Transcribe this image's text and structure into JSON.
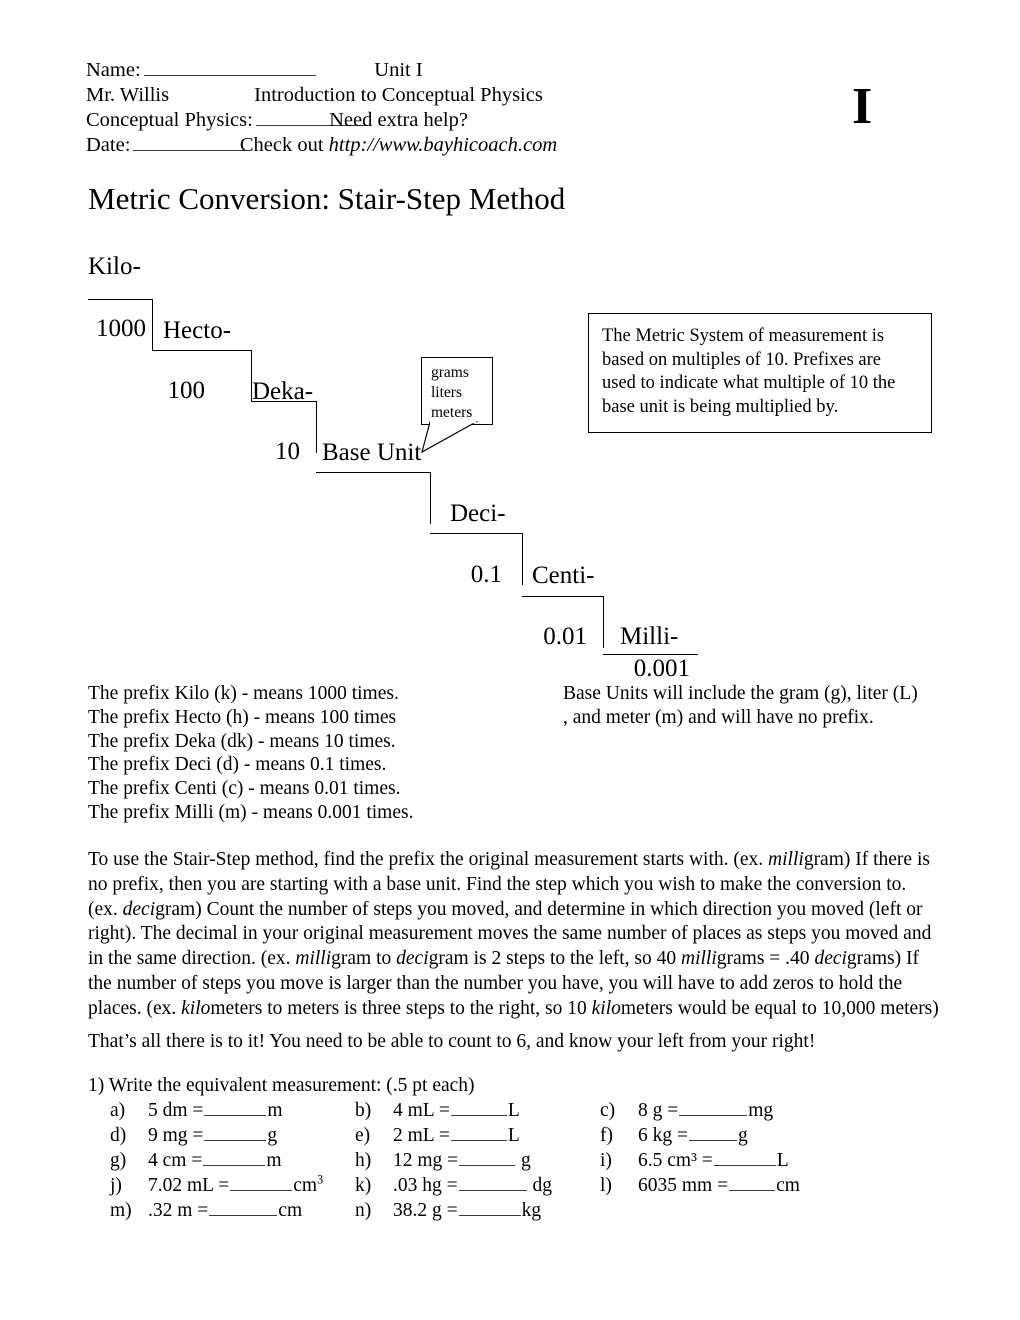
{
  "header": {
    "name_label": "Name:",
    "teacher": "Mr. Willis",
    "course_label": "Conceptual Physics:",
    "date_label": "Date:",
    "unit": "Unit I",
    "subtitle": "Introduction to Conceptual Physics",
    "help_line": "Need extra help?",
    "checkout_prefix": "Check out ",
    "website": "http://www.bayhicoach.com",
    "unit_letter": "I"
  },
  "title": "Metric Conversion: Stair-Step Method",
  "stairs": {
    "steps": [
      {
        "prefix": "Kilo-",
        "value": "1000"
      },
      {
        "prefix": "Hecto-",
        "value": "100"
      },
      {
        "prefix": "Deka-",
        "value": "10"
      },
      {
        "prefix": "Base Unit",
        "value": "0.1"
      },
      {
        "prefix": "Deci-",
        "value": "0.01"
      },
      {
        "prefix": "Centi-",
        "value": "0.001"
      },
      {
        "prefix": "Milli-",
        "value": ""
      }
    ],
    "callout": {
      "line1": "grams",
      "line2": "liters",
      "line3": "meters"
    }
  },
  "infobox": {
    "text": "The Metric System of measurement is based on multiples of 10.  Prefixes are used to indicate what multiple of 10 the base unit is being multiplied by."
  },
  "prefix_list": [
    "The prefix Kilo (k) - means 1000 times.",
    "The prefix Hecto (h) - means 100 times",
    "The prefix Deka (dk) - means 10 times.",
    "The prefix Deci (d) - means 0.1 times.",
    "The prefix Centi (c) - means 0.01 times.",
    "The prefix Milli (m) - means 0.001 times."
  ],
  "baseunit_note": "Base Units will include the gram (g), liter (L) , and meter (m) and will have no prefix.",
  "method": {
    "p1_a": "To use the Stair-Step method, find the prefix the original measurement starts with. (ex. ",
    "p1_i1": "milli",
    "p1_b": "gram)  If there is no prefix, then you are starting with a base unit.  Find the step which you wish to make the conversion to. (ex. ",
    "p1_i2": "deci",
    "p1_c": "gram)  Count the number of steps you moved, and determine in which direction you moved (left or right).  The decimal in your original measurement moves the same number of places as steps you moved and in the same direction. (ex. ",
    "p1_i3": "milli",
    "p1_d": "gram to ",
    "p1_i4": "deci",
    "p1_e": "gram is 2 steps to the left, so 40 ",
    "p1_i5": "milli",
    "p1_f": "grams = .40 ",
    "p1_i6": "deci",
    "p1_g": "grams)  If the number of steps you move is larger than the number you have, you will have to add zeros to hold the places. (ex. ",
    "p1_i7": "kilo",
    "p1_h": "meters to meters is three steps to the right, so 10 ",
    "p1_i8": "kilo",
    "p1_i": "meters would be equal to 10,000 meters)",
    "closing": "That’s all there is to it! You need to be able to count to 6, and know your left from your right!"
  },
  "exercises": {
    "heading": "1) Write the equivalent measurement: (.5 pt each)",
    "rows": [
      [
        {
          "letter": "a)",
          "question": "5 dm = ",
          "blank_width": 62,
          "unit": "m",
          "sup": ""
        },
        {
          "letter": "b)",
          "question": "4 mL = ",
          "blank_width": 56,
          "unit": "L",
          "sup": ""
        },
        {
          "letter": "c)",
          "question": "8 g = ",
          "blank_width": 68,
          "unit": "mg",
          "sup": ""
        }
      ],
      [
        {
          "letter": "d)",
          "question": "9 mg = ",
          "blank_width": 62,
          "unit": "g",
          "sup": ""
        },
        {
          "letter": "e)",
          "question": "2 mL = ",
          "blank_width": 56,
          "unit": "L",
          "sup": ""
        },
        {
          "letter": "f)",
          "question": "6 kg = ",
          "blank_width": 48,
          "unit": "g",
          "sup": ""
        }
      ],
      [
        {
          "letter": "g)",
          "question": "4 cm = ",
          "blank_width": 62,
          "unit": "m",
          "sup": ""
        },
        {
          "letter": "h)",
          "question": "12 mg = ",
          "blank_width": 56,
          "unit": " g",
          "sup": ""
        },
        {
          "letter": "i)",
          "question": "6.5 cm³ = ",
          "blank_width": 62,
          "unit": "L",
          "sup": ""
        }
      ],
      [
        {
          "letter": "j)",
          "question": "7.02 mL = ",
          "blank_width": 62,
          "unit": "cm",
          "sup": "3"
        },
        {
          "letter": "k)",
          "question": ".03 hg = ",
          "blank_width": 68,
          "unit": " dg",
          "sup": ""
        },
        {
          "letter": "l)",
          "question": "6035 mm = ",
          "blank_width": 46,
          "unit": "cm",
          "sup": ""
        }
      ],
      [
        {
          "letter": "m)",
          "question": ".32 m = ",
          "blank_width": 68,
          "unit": "cm",
          "sup": ""
        },
        {
          "letter": "n)",
          "question": "38.2 g = ",
          "blank_width": 62,
          "unit": "kg",
          "sup": ""
        },
        null
      ]
    ]
  }
}
